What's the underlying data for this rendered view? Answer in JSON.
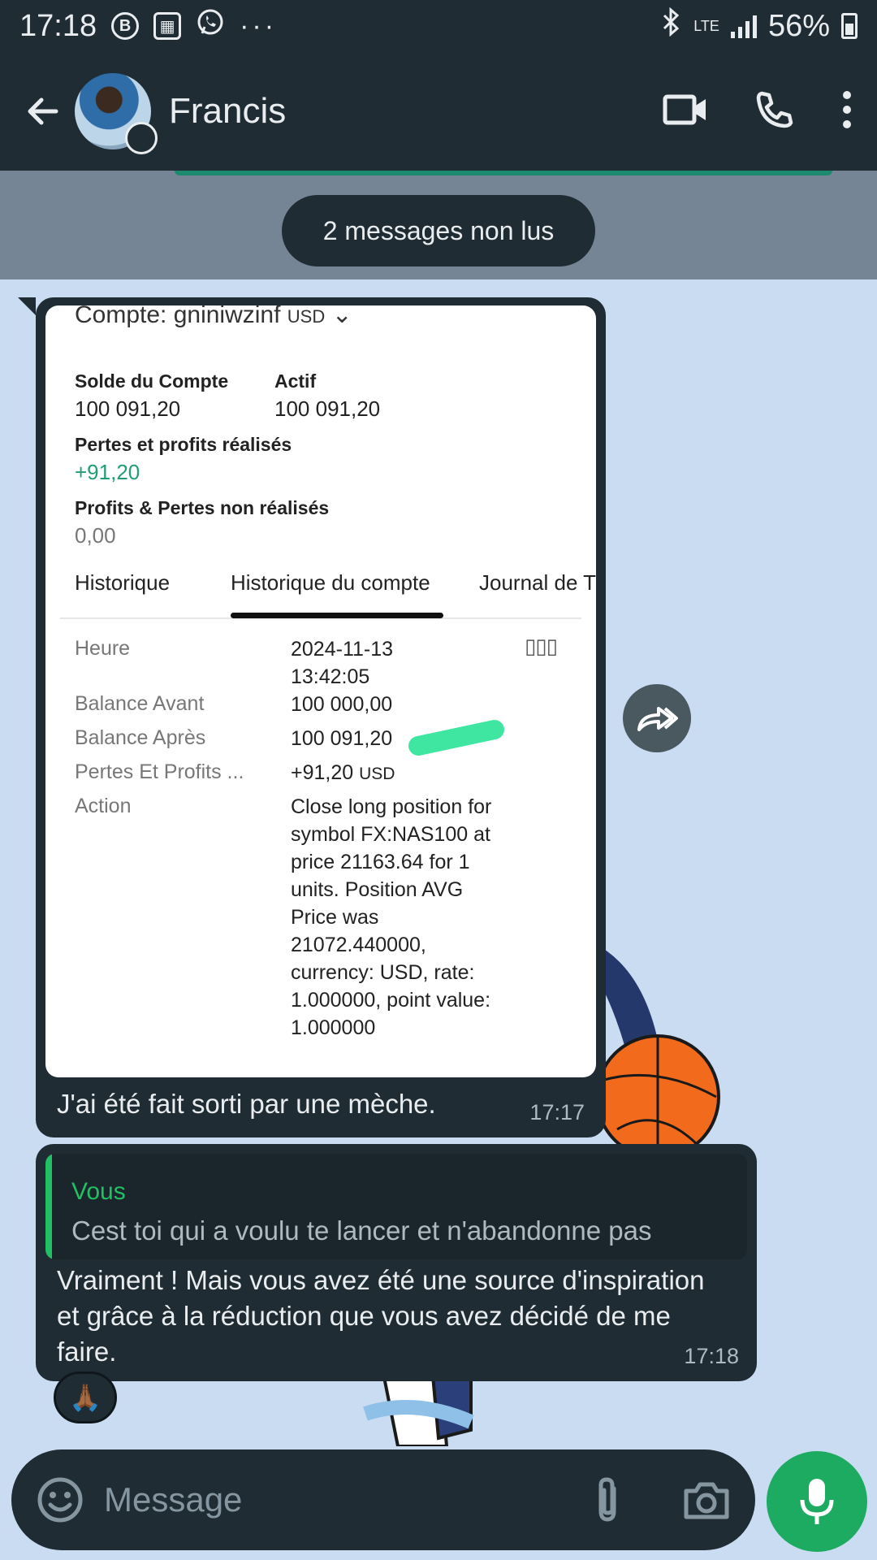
{
  "status_bar": {
    "time": "17:18",
    "network": "LTE",
    "battery": "56%"
  },
  "header": {
    "contact_name": "Francis"
  },
  "unread_banner": "2 messages non lus",
  "messages": [
    {
      "screenshot": {
        "account_label": "Compte: gniniwzinf",
        "account_currency": "USD",
        "balance_label": "Solde du Compte",
        "balance_value": "100 091,20",
        "equity_label": "Actif",
        "equity_value": "100 091,20",
        "realized_label": "Pertes et profits réalisés",
        "realized_value": "+91,20",
        "unrealized_label": "Profits & Pertes non réalisés",
        "unrealized_value": "0,00",
        "tabs": [
          "Historique",
          "Historique du compte",
          "Journal de T"
        ],
        "rows": [
          {
            "label": "Heure",
            "value": "2024-11-13\n13:42:05"
          },
          {
            "label": "Balance Avant",
            "value": "100 000,00"
          },
          {
            "label": "Balance Après",
            "value": "100 091,20"
          },
          {
            "label": "Pertes Et Profits ...",
            "value": "+91,20",
            "unit": "USD"
          },
          {
            "label": "Action",
            "value": "Close long position for symbol FX:NAS100 at price 21163.64 for 1 units. Position AVG Price was 21072.440000, currency: USD, rate: 1.000000, point value: 1.000000"
          }
        ]
      },
      "caption": "J'ai été fait sorti par une mèche.",
      "time": "17:17"
    },
    {
      "quote_author": "Vous",
      "quote_text": "Cest toi qui a voulu te lancer et n'abandonne pas",
      "text": "Vraiment ! Mais vous avez été une source d'inspiration et grâce à la réduction que vous avez décidé de me faire.",
      "time": "17:18",
      "reaction": "🙏🏾"
    }
  ],
  "composer": {
    "placeholder": "Message"
  }
}
